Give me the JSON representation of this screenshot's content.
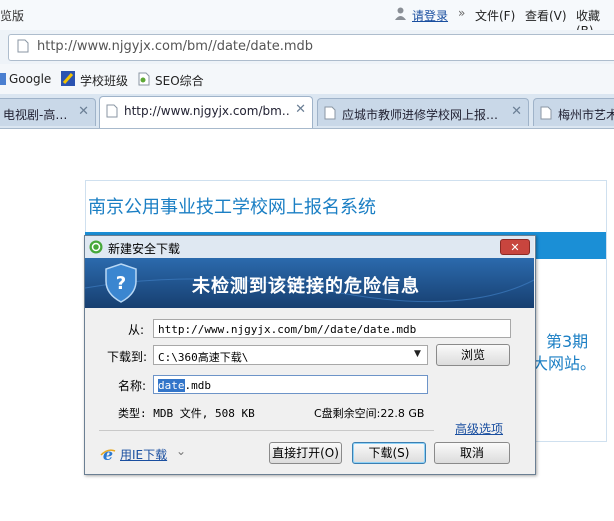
{
  "menubar": {
    "app_title": "览版",
    "login": "请登录",
    "menus": [
      "文件(F)",
      "查看(V)",
      "收藏(B)"
    ]
  },
  "address": {
    "url": "http://www.njgyjx.com/bm//date/date.mdb"
  },
  "favorites": [
    "Google",
    "学校班级",
    "SEO综合"
  ],
  "tabs": [
    {
      "label": "电视剧-高…",
      "active": false
    },
    {
      "label": "http://www.njgyjx.com/bm…",
      "active": true
    },
    {
      "label": "应城市教师进修学校网上报…",
      "active": false
    },
    {
      "label": "梅州市艺术",
      "active": false
    }
  ],
  "page": {
    "site_title": "南京公用事业技工学校网上报名系统",
    "side_text1": "第3期",
    "side_text2": "大网站。"
  },
  "dialog": {
    "title": "新建安全下载",
    "banner": "未检测到该链接的危险信息",
    "from_label": "从:",
    "from_value": "http://www.njgyjx.com/bm//date/date.mdb",
    "to_label": "下载到:",
    "to_value": "C:\\360高速下载\\",
    "browse": "浏览",
    "name_label": "名称:",
    "name_selected": "date",
    "name_rest": ".mdb",
    "type_info": "类型: MDB 文件, 508 KB",
    "free_space": "C盘剩余空间:22.8 GB",
    "advanced": "高级选项",
    "ie_download": "用IE下载",
    "open_direct": "直接打开(O)",
    "download": "下载(S)",
    "cancel": "取消"
  },
  "colors": {
    "accent": "#1b8fd6",
    "banner": "#1d4f8a",
    "link": "#1a4fa0"
  }
}
